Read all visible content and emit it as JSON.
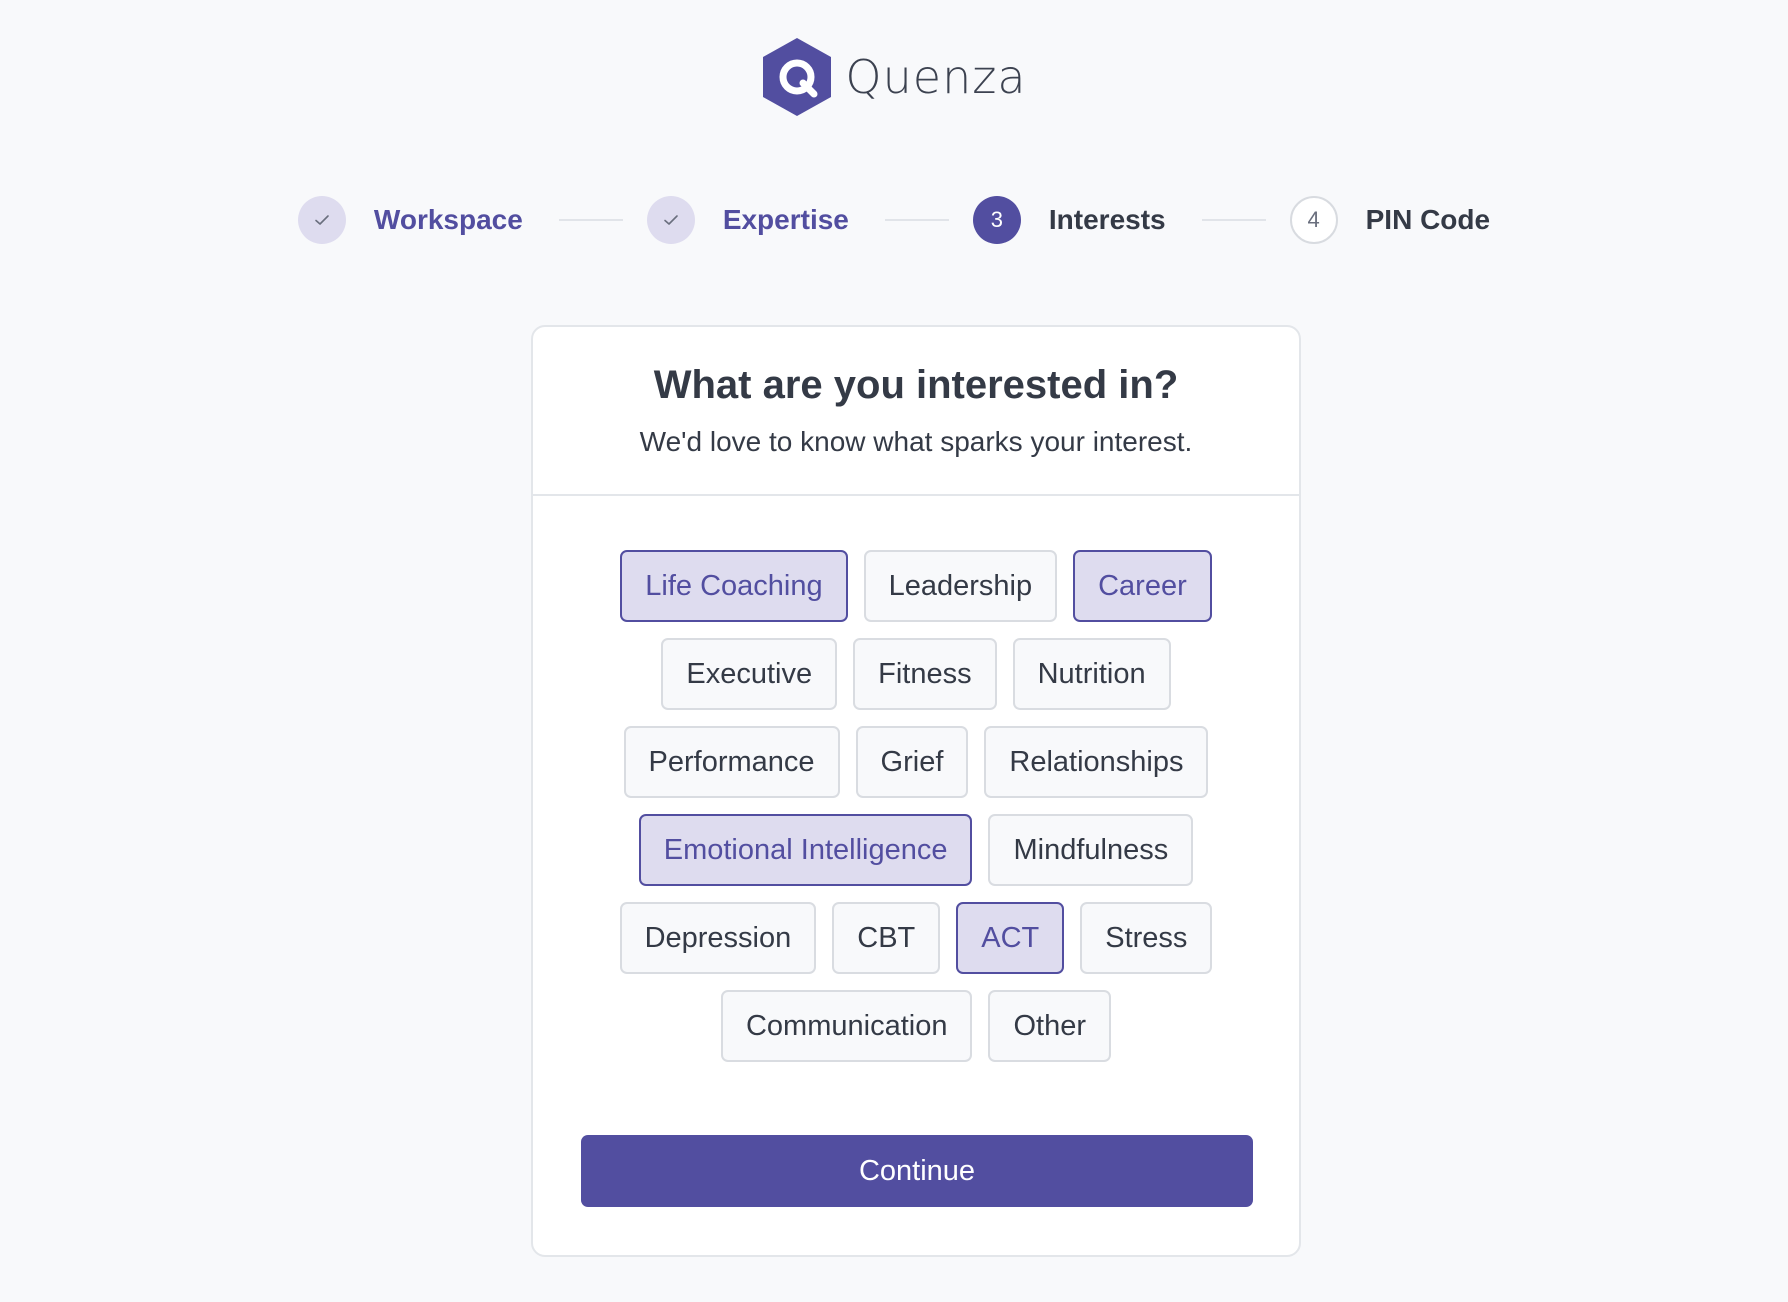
{
  "brand": {
    "name": "Quenza",
    "accent_color": "#524ea0"
  },
  "stepper": {
    "steps": [
      {
        "number": "",
        "label": "Workspace",
        "status": "done"
      },
      {
        "number": "",
        "label": "Expertise",
        "status": "done"
      },
      {
        "number": "3",
        "label": "Interests",
        "status": "active"
      },
      {
        "number": "4",
        "label": "PIN Code",
        "status": "pending"
      }
    ]
  },
  "card": {
    "title": "What are you interested in?",
    "subtitle": "We'd love to know what sparks your interest."
  },
  "interests": [
    {
      "label": "Life Coaching",
      "selected": true
    },
    {
      "label": "Leadership",
      "selected": false
    },
    {
      "label": "Career",
      "selected": true
    },
    {
      "label": "Executive",
      "selected": false
    },
    {
      "label": "Fitness",
      "selected": false
    },
    {
      "label": "Nutrition",
      "selected": false
    },
    {
      "label": "Performance",
      "selected": false
    },
    {
      "label": "Grief",
      "selected": false
    },
    {
      "label": "Relationships",
      "selected": false
    },
    {
      "label": "Emotional Intelligence",
      "selected": true
    },
    {
      "label": "Mindfulness",
      "selected": false
    },
    {
      "label": "Depression",
      "selected": false
    },
    {
      "label": "CBT",
      "selected": false
    },
    {
      "label": "ACT",
      "selected": true
    },
    {
      "label": "Stress",
      "selected": false
    },
    {
      "label": "Communication",
      "selected": false
    },
    {
      "label": "Other",
      "selected": false
    }
  ],
  "actions": {
    "continue_label": "Continue"
  }
}
